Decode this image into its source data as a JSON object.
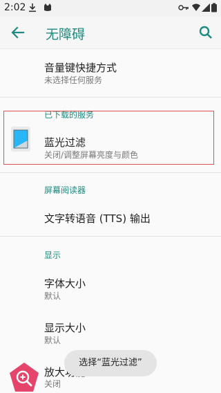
{
  "status_bar": {
    "time": "2:02"
  },
  "app_bar": {
    "title": "无障碍"
  },
  "items": {
    "volume_shortcut": {
      "title": "音量键快捷方式",
      "subtitle": "未选择任何服务"
    },
    "section_downloaded": "已下载的服务",
    "blue_light": {
      "title": "蓝光过滤",
      "subtitle": "关闭/调整屏幕亮度与颜色"
    },
    "section_screen_reader": "屏幕阅读器",
    "tts": {
      "title": "文字转语音 (TTS) 输出"
    },
    "section_display": "显示",
    "font_size": {
      "title": "字体大小",
      "subtitle": "默认"
    },
    "display_size": {
      "title": "显示大小",
      "subtitle": "默认"
    },
    "magnification": {
      "title": "放大功能",
      "subtitle": "关闭"
    }
  },
  "toast": {
    "text": "选择“蓝光过滤”"
  },
  "colors": {
    "accent": "#1f8a7f",
    "fab": "#e5456a",
    "highlight": "#e05050"
  }
}
